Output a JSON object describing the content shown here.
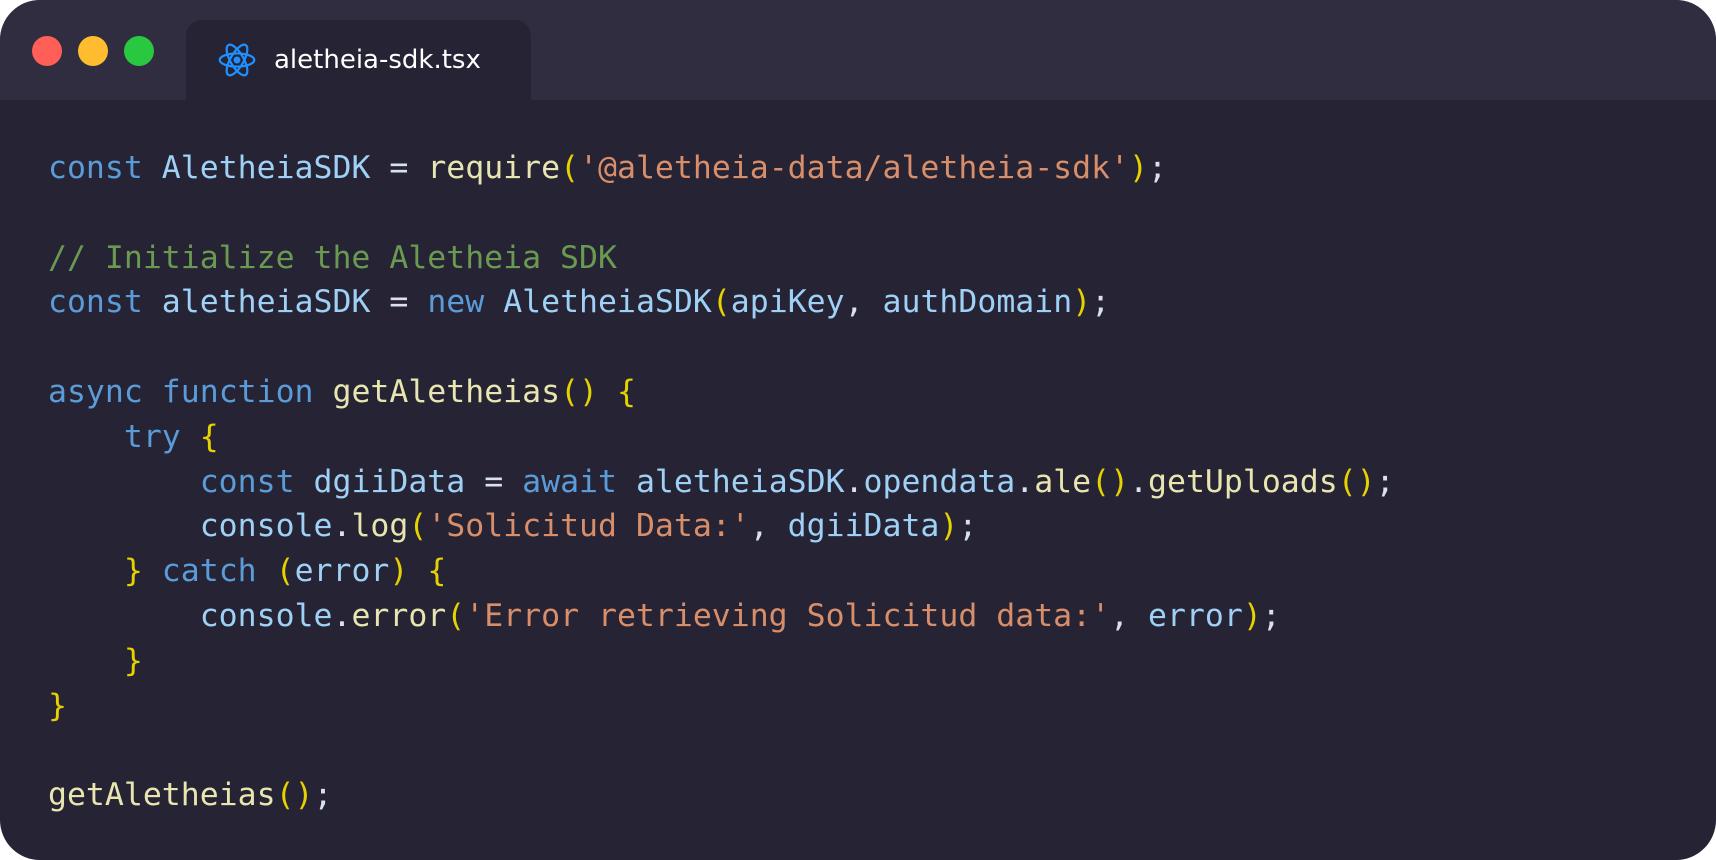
{
  "window": {
    "traffic_lights": [
      {
        "name": "close",
        "color": "#ff5f57"
      },
      {
        "name": "minimize",
        "color": "#febc2e"
      },
      {
        "name": "zoom",
        "color": "#28c840"
      }
    ],
    "tab": {
      "icon": "react-icon",
      "icon_color": "#1e90ff",
      "filename": "aletheia-sdk.tsx"
    }
  },
  "theme": {
    "keyword": "#5a9bd8",
    "ident": "#9fd0f5",
    "func": "#e8e5b0",
    "string": "#d98e6a",
    "comment": "#6a9a52",
    "bracket": "#e6d200",
    "punct": "#d9e0ee"
  },
  "code": {
    "lines": [
      [
        [
          "keyword",
          "const"
        ],
        [
          "punct",
          " "
        ],
        [
          "ident",
          "AletheiaSDK"
        ],
        [
          "punct",
          " = "
        ],
        [
          "func",
          "require"
        ],
        [
          "bracket",
          "("
        ],
        [
          "string",
          "'@aletheia-data/aletheia-sdk'"
        ],
        [
          "bracket",
          ")"
        ],
        [
          "punct",
          ";"
        ]
      ],
      [],
      [
        [
          "comment",
          "// Initialize the Aletheia SDK"
        ]
      ],
      [
        [
          "keyword",
          "const"
        ],
        [
          "punct",
          " "
        ],
        [
          "ident",
          "aletheiaSDK"
        ],
        [
          "punct",
          " = "
        ],
        [
          "keyword",
          "new"
        ],
        [
          "punct",
          " "
        ],
        [
          "ident",
          "AletheiaSDK"
        ],
        [
          "bracket",
          "("
        ],
        [
          "ident",
          "apiKey"
        ],
        [
          "punct",
          ", "
        ],
        [
          "ident",
          "authDomain"
        ],
        [
          "bracket",
          ")"
        ],
        [
          "punct",
          ";"
        ]
      ],
      [],
      [
        [
          "keyword",
          "async"
        ],
        [
          "punct",
          " "
        ],
        [
          "keyword",
          "function"
        ],
        [
          "punct",
          " "
        ],
        [
          "func",
          "getAletheias"
        ],
        [
          "bracket",
          "()"
        ],
        [
          "punct",
          " "
        ],
        [
          "bracket",
          "{"
        ]
      ],
      [
        [
          "punct",
          "    "
        ],
        [
          "keyword",
          "try"
        ],
        [
          "punct",
          " "
        ],
        [
          "bracket",
          "{"
        ]
      ],
      [
        [
          "punct",
          "        "
        ],
        [
          "keyword",
          "const"
        ],
        [
          "punct",
          " "
        ],
        [
          "ident",
          "dgiiData"
        ],
        [
          "punct",
          " = "
        ],
        [
          "keyword",
          "await"
        ],
        [
          "punct",
          " "
        ],
        [
          "ident",
          "aletheiaSDK"
        ],
        [
          "punct",
          "."
        ],
        [
          "ident",
          "opendata"
        ],
        [
          "punct",
          "."
        ],
        [
          "func",
          "ale"
        ],
        [
          "bracket",
          "()"
        ],
        [
          "punct",
          "."
        ],
        [
          "func",
          "getUploads"
        ],
        [
          "bracket",
          "()"
        ],
        [
          "punct",
          ";"
        ]
      ],
      [
        [
          "punct",
          "        "
        ],
        [
          "ident",
          "console"
        ],
        [
          "punct",
          "."
        ],
        [
          "func",
          "log"
        ],
        [
          "bracket",
          "("
        ],
        [
          "string",
          "'Solicitud Data:'"
        ],
        [
          "punct",
          ", "
        ],
        [
          "ident",
          "dgiiData"
        ],
        [
          "bracket",
          ")"
        ],
        [
          "punct",
          ";"
        ]
      ],
      [
        [
          "punct",
          "    "
        ],
        [
          "bracket",
          "}"
        ],
        [
          "punct",
          " "
        ],
        [
          "keyword",
          "catch"
        ],
        [
          "punct",
          " "
        ],
        [
          "bracket",
          "("
        ],
        [
          "ident",
          "error"
        ],
        [
          "bracket",
          ")"
        ],
        [
          "punct",
          " "
        ],
        [
          "bracket",
          "{"
        ]
      ],
      [
        [
          "punct",
          "        "
        ],
        [
          "ident",
          "console"
        ],
        [
          "punct",
          "."
        ],
        [
          "func",
          "error"
        ],
        [
          "bracket",
          "("
        ],
        [
          "string",
          "'Error retrieving Solicitud data:'"
        ],
        [
          "punct",
          ", "
        ],
        [
          "ident",
          "error"
        ],
        [
          "bracket",
          ")"
        ],
        [
          "punct",
          ";"
        ]
      ],
      [
        [
          "punct",
          "    "
        ],
        [
          "bracket",
          "}"
        ]
      ],
      [
        [
          "bracket",
          "}"
        ]
      ],
      [],
      [
        [
          "func",
          "getAletheias"
        ],
        [
          "bracket",
          "()"
        ],
        [
          "punct",
          ";"
        ]
      ]
    ]
  }
}
